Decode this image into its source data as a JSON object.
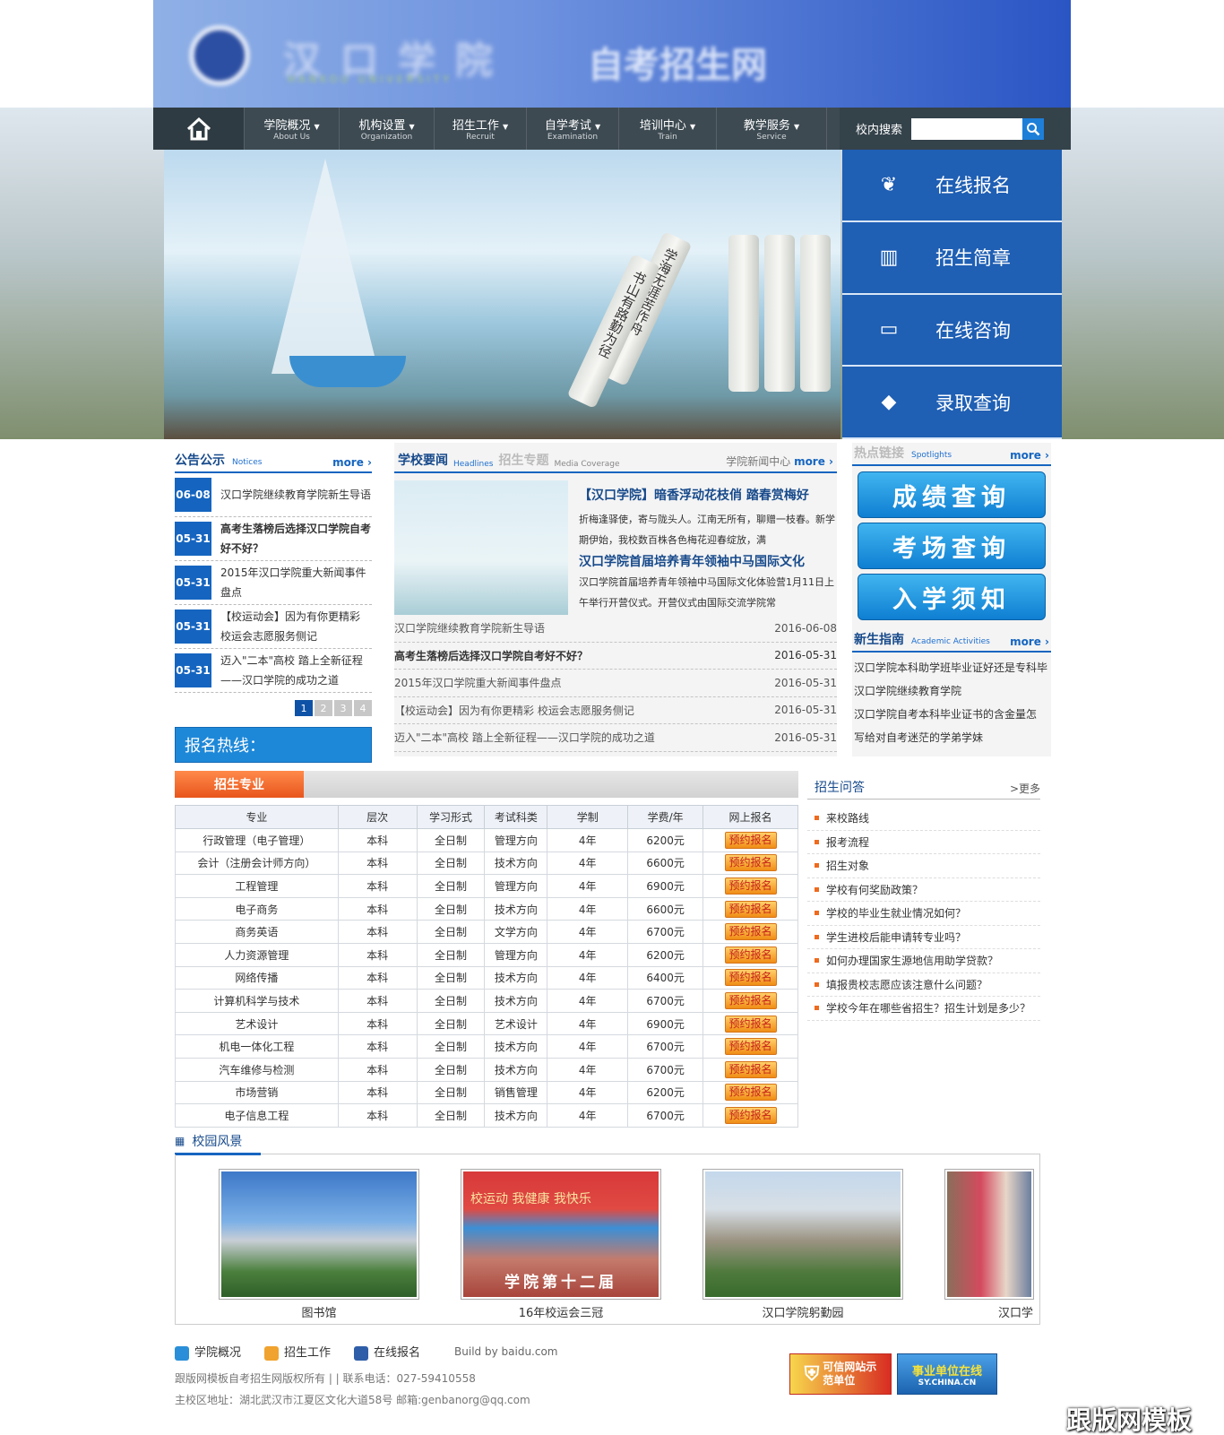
{
  "header": {
    "logo_title": "自考招生网"
  },
  "nav": {
    "items": [
      {
        "cn": "学院概况",
        "en": "About Us"
      },
      {
        "cn": "机构设置",
        "en": "Organization"
      },
      {
        "cn": "招生工作",
        "en": "Recruit"
      },
      {
        "cn": "自学考试",
        "en": "Examination"
      },
      {
        "cn": "培训中心",
        "en": "Train"
      },
      {
        "cn": "教学服务",
        "en": "Service"
      }
    ],
    "search_label": "校内搜索",
    "search_placeholder": ""
  },
  "banner": {
    "scroll1": "学海无涯苦作舟",
    "scroll2": "书山有路勤为径"
  },
  "quick_links": [
    {
      "label": "在线报名",
      "icon": "sprout-icon"
    },
    {
      "label": "招生简章",
      "icon": "book-icon"
    },
    {
      "label": "在线咨询",
      "icon": "monitor-icon"
    },
    {
      "label": "录取查询",
      "icon": "graduation-cap-icon"
    }
  ],
  "notices": {
    "title": "公告公示",
    "en": "Notices",
    "more": "more",
    "items": [
      {
        "date": "06-08",
        "text": "汉口学院继续教育学院新生导语",
        "bold": false
      },
      {
        "date": "05-31",
        "text": "高考生落榜后选择汉口学院自考好不好？",
        "bold": true
      },
      {
        "date": "05-31",
        "text": "2015年汉口学院重大新闻事件盘点",
        "bold": false
      },
      {
        "date": "05-31",
        "text": "【校运动会】因为有你更精彩 校运会志愿服务侧记",
        "bold": false
      },
      {
        "date": "05-31",
        "text": "迈入\"二本\"高校 踏上全新征程——汉口学院的成功之道",
        "bold": false
      }
    ],
    "pages": [
      "1",
      "2",
      "3",
      "4"
    ],
    "hotline": "报名热线："
  },
  "news": {
    "tab1": "学校要闻",
    "tab1_en": "Headlines",
    "tab2": "招生专题",
    "tab2_en": "Media Coverage",
    "center": "学院新闻中心",
    "more": "more",
    "featured_title": "【汉口学院】暗香浮动花枝俏 踏春赏梅好",
    "featured_text": "折梅逢驿使，寄与陇头人。江南无所有，聊赠一枝春。新学期伊始，我校数百株各色梅花迎春绽放，满",
    "featured2_title": "汉口学院首届培养青年领袖中马国际文化",
    "featured2_text": "汉口学院首届培养青年领袖中马国际文化体验营1月11日上午举行开营仪式。开营仪式由国际交流学院常",
    "rows": [
      {
        "title": "汉口学院继续教育学院新生导语",
        "date": "2016-06-08",
        "bold": false
      },
      {
        "title": "高考生落榜后选择汉口学院自考好不好？",
        "date": "2016-05-31",
        "bold": true
      },
      {
        "title": "2015年汉口学院重大新闻事件盘点",
        "date": "2016-05-31",
        "bold": false
      },
      {
        "title": "【校运动会】因为有你更精彩 校运会志愿服务侧记",
        "date": "2016-05-31",
        "bold": false
      },
      {
        "title": "迈入\"二本\"高校 踏上全新征程——汉口学院的成功之道",
        "date": "2016-05-31",
        "bold": false
      }
    ]
  },
  "hot": {
    "title": "热点链接",
    "en": "Spotlights",
    "more": "more",
    "buttons": [
      "成绩查询",
      "考场查询",
      "入学须知"
    ],
    "guide_title": "新生指南",
    "guide_en": "Academic Activities",
    "guide_more": "more",
    "guide": [
      "汉口学院本科助学班毕业证好还是专科毕",
      "汉口学院继续教育学院",
      "汉口学院自考本科毕业证书的含金量怎",
      "写给对自考迷茫的学弟学妹"
    ]
  },
  "majors": {
    "tab": "招生专业",
    "headers": [
      "专业",
      "层次",
      "学习形式",
      "考试科类",
      "学制",
      "学费/年",
      "网上报名"
    ],
    "sign": "预约报名",
    "rows": [
      [
        "行政管理（电子管理）",
        "本科",
        "全日制",
        "管理方向",
        "4年",
        "6200元"
      ],
      [
        "会计（注册会计师方向）",
        "本科",
        "全日制",
        "技术方向",
        "4年",
        "6600元"
      ],
      [
        "工程管理",
        "本科",
        "全日制",
        "管理方向",
        "4年",
        "6900元"
      ],
      [
        "电子商务",
        "本科",
        "全日制",
        "技术方向",
        "4年",
        "6600元"
      ],
      [
        "商务英语",
        "本科",
        "全日制",
        "文学方向",
        "4年",
        "6700元"
      ],
      [
        "人力资源管理",
        "本科",
        "全日制",
        "管理方向",
        "4年",
        "6200元"
      ],
      [
        "网络传播",
        "本科",
        "全日制",
        "技术方向",
        "4年",
        "6400元"
      ],
      [
        "计算机科学与技术",
        "本科",
        "全日制",
        "技术方向",
        "4年",
        "6700元"
      ],
      [
        "艺术设计",
        "本科",
        "全日制",
        "艺术设计",
        "4年",
        "6900元"
      ],
      [
        "机电一体化工程",
        "本科",
        "全日制",
        "技术方向",
        "4年",
        "6700元"
      ],
      [
        "汽车维修与检测",
        "本科",
        "全日制",
        "技术方向",
        "4年",
        "6700元"
      ],
      [
        "市场营销",
        "本科",
        "全日制",
        "销售管理",
        "4年",
        "6200元"
      ],
      [
        "电子信息工程",
        "本科",
        "全日制",
        "技术方向",
        "4年",
        "6700元"
      ]
    ]
  },
  "qa": {
    "title": "招生问答",
    "more": ">更多",
    "items": [
      "来校路线",
      "报考流程",
      "招生对象",
      "学校有何奖励政策？",
      "学校的毕业生就业情况如何？",
      "学生进校后能申请转专业吗？",
      "如何办理国家生源地信用助学贷款？",
      "填报贵校志愿应该注意什么问题？",
      "学校今年在哪些省招生？招生计划是多少？"
    ]
  },
  "campus": {
    "title": "校园风景",
    "photos": [
      {
        "caption": "图书馆",
        "banner": ""
      },
      {
        "caption": "16年校运会三冠",
        "banner": "校运动 我健康 我快乐",
        "banner2": "学院第十二届"
      },
      {
        "caption": "汉口学院躬勤园",
        "banner": ""
      },
      {
        "caption": "汉口学",
        "banner": ""
      }
    ]
  },
  "footer": {
    "links": [
      "学院概况",
      "招生工作",
      "在线报名"
    ],
    "build": "Build by baidu.com",
    "copy1": "跟版网模板自考招生网版权所有 | | 联系电话：027-59410558",
    "copy2": "主校区地址：湖北武汉市江夏区文化大道58号 邮箱:genbanorg@qq.com",
    "badge1": "可信网站示范单位",
    "badge2": "事业单位在线",
    "badge2_sub": "SY.CHINA.CN"
  },
  "watermark": "跟版网模板",
  "colors": {
    "primary": "#1565c0",
    "nav": "#3d4a52",
    "quick": "#1f5fb4",
    "accent": "#e8551c"
  }
}
